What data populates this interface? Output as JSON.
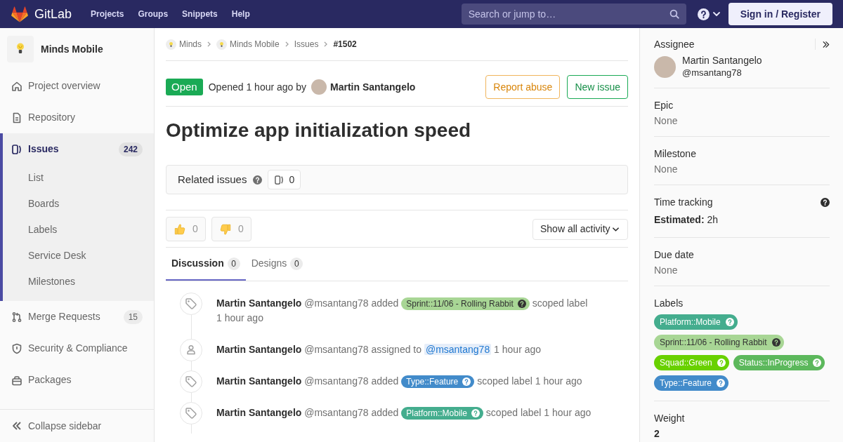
{
  "top_bar": {
    "brand": "GitLab",
    "nav": [
      "Projects",
      "Groups",
      "Snippets",
      "Help"
    ],
    "search": {
      "placeholder": "Search or jump to…"
    },
    "sign_in": "Sign in / Register"
  },
  "sidebar": {
    "project": "Minds Mobile",
    "items": [
      {
        "label": "Project overview",
        "selected": false
      },
      {
        "label": "Repository",
        "selected": false
      },
      {
        "label": "Issues",
        "count": "242",
        "selected": true,
        "children": [
          {
            "label": "List",
            "selected": false
          },
          {
            "label": "Boards",
            "selected": false
          },
          {
            "label": "Labels",
            "selected": false
          },
          {
            "label": "Service Desk",
            "selected": false
          },
          {
            "label": "Milestones",
            "selected": false
          }
        ]
      },
      {
        "label": "Merge Requests",
        "count": "15",
        "selected": false
      },
      {
        "label": "Security & Compliance",
        "selected": false
      },
      {
        "label": "Packages",
        "selected": false
      }
    ],
    "collapse": "Collapse sidebar"
  },
  "breadcrumbs": [
    {
      "label": "Minds",
      "kind": "group"
    },
    {
      "label": "Minds Mobile",
      "kind": "project"
    },
    {
      "label": "Issues",
      "kind": "link"
    },
    {
      "label": "#1502",
      "kind": "current"
    }
  ],
  "issue": {
    "status": {
      "text": "Open",
      "kind": "open"
    },
    "opened": "Opened 1 hour ago by",
    "author": "Martin Santangelo",
    "buttons": [
      {
        "label": "Report abuse",
        "kind": "warning"
      },
      {
        "label": "New issue",
        "kind": "success"
      }
    ],
    "title": "Optimize app initialization speed"
  },
  "related_issues": {
    "title": "Related issues",
    "count": "0"
  },
  "awards": [
    {
      "count": "0"
    },
    {
      "count": "0"
    }
  ],
  "activity_filter": "Show all activity",
  "tabs": [
    {
      "label": "Discussion",
      "count": "0",
      "selected": true
    },
    {
      "label": "Designs",
      "count": "0",
      "selected": false
    }
  ],
  "timeline": [
    {
      "kind": "label",
      "author": "Martin Santangelo",
      "handle": "@msantang78",
      "action": "added",
      "label": {
        "text": "Sprint::11/06 - Rolling Rabbit",
        "color": "#a8d695"
      },
      "suffix": "scoped label",
      "time": "1 hour ago"
    },
    {
      "kind": "assign",
      "author": "Martin Santangelo",
      "handle": "@msantang78",
      "action": "assigned to",
      "mention": "@msantang78",
      "time": "1 hour ago"
    },
    {
      "kind": "label",
      "author": "Martin Santangelo",
      "handle": "@msantang78",
      "action": "added",
      "label": {
        "text": "Type::Feature",
        "color": "#428bca"
      },
      "suffix": "scoped label",
      "time": "1 hour ago"
    },
    {
      "kind": "label",
      "author": "Martin Santangelo",
      "handle": "@msantang78",
      "action": "added",
      "label": {
        "text": "Platform::Mobile",
        "color": "#44ad8e"
      },
      "suffix": "scoped label",
      "time": "1 hour ago"
    }
  ],
  "right_sidebar": {
    "sections": [
      {
        "kind": "assignee",
        "title": "Assignee",
        "name": "Martin Santangelo",
        "handle": "@msantang78"
      },
      {
        "kind": "empty",
        "title": "Epic",
        "value": "None"
      },
      {
        "kind": "empty",
        "title": "Milestone",
        "value": "None"
      },
      {
        "kind": "time",
        "title": "Time tracking",
        "value": "**Estimated:** 2h"
      },
      {
        "kind": "empty",
        "title": "Due date",
        "value": "None"
      },
      {
        "kind": "labels",
        "title": "Labels",
        "labels": [
          {
            "text": "Platform::Mobile",
            "color": "#44ad8e"
          },
          {
            "text": "Sprint::11/06 - Rolling Rabbit",
            "color": "#a8d695"
          },
          {
            "text": "Squad::Green",
            "color": "#69d100"
          },
          {
            "text": "Status::InProgress",
            "color": "#5cb85c"
          },
          {
            "text": "Type::Feature",
            "color": "#428bca"
          }
        ]
      },
      {
        "kind": "number",
        "title": "Weight",
        "value": "2"
      }
    ]
  }
}
